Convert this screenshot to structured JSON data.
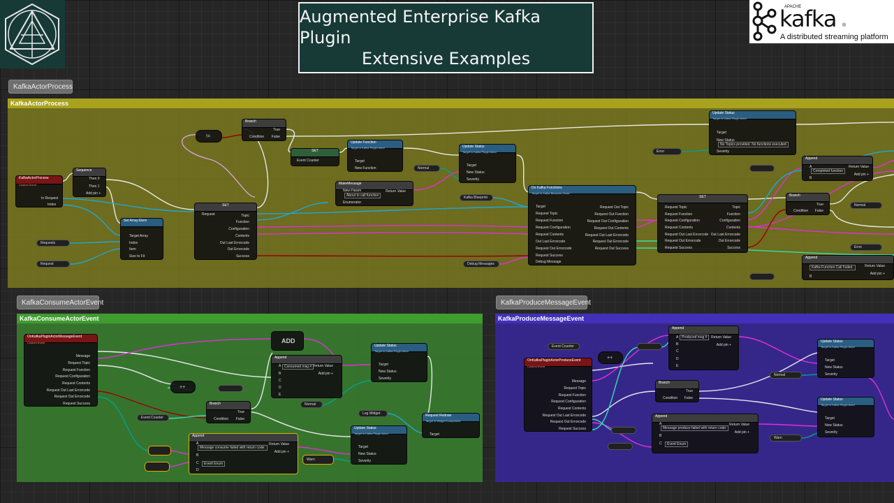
{
  "header": {
    "title_line1": "Augmented Enterprise Kafka Plugin",
    "title_line2": "Extensive Examples",
    "kafka_apache": "APACHE",
    "kafka_word": "kafka",
    "kafka_reg": "®",
    "kafka_tagline": "A distributed streaming platform"
  },
  "colors": {
    "exec": "#ffffff",
    "string": "#e02fd8",
    "object": "#1fa6d6",
    "enum": "#00a38e",
    "bool": "#9a0000",
    "int": "#33e0b0",
    "olive": "#8a8a1e",
    "green": "#2e8a2c",
    "purple": "#3a2d9e"
  },
  "groups": {
    "actor": {
      "tab": "KafkaActorProcess",
      "header": "KafkaActorProcess"
    },
    "consume": {
      "tab": "KafkaConsumeActorEvent",
      "header": "KafkaConsumeActorEvent"
    },
    "produce": {
      "tab": "KafkaProduceMessageEvent",
      "header": "KafkaProduceMessageEvent"
    }
  },
  "nodes": {
    "kap": {
      "title": "KafkaActorProcess",
      "sub": "Custom Event",
      "p1": "In Request",
      "p2": "Index"
    },
    "seq": {
      "title": "Sequence",
      "p1": "Then 0",
      "p2": "Then 1",
      "p3": "Add pin +"
    },
    "setarr": {
      "title": "Set Array Elem",
      "p1": "Target Array",
      "p2": "Index",
      "p3": "Item",
      "p4": "Size to Fit"
    },
    "requests": "Requests",
    "request": "Request",
    "set1": {
      "title": "SET",
      "p1": "Request",
      "p2": "Topic",
      "p3": "Function",
      "p4": "Configuration",
      "p5": "Contents",
      "p6": "Out Last Errorcode",
      "p7": "Out Errorcode",
      "p8": "Success"
    },
    "branch1": {
      "title": "Branch",
      "p1": "Condition",
      "p2": "True",
      "p3": "False"
    },
    "set_ec": {
      "title": "SET",
      "p1": "Event Counter"
    },
    "updfunc": {
      "title": "Update Function",
      "sub": "Target is Kafka Plugin Actor",
      "p1": "Target",
      "p2": "New Function"
    },
    "makemsg": {
      "title": "MakeMessage",
      "p1": "New Param",
      "p2": "Enumerator",
      "p3": "Return Value",
      "val": "About to call function"
    },
    "upd1": {
      "title": "Update Status",
      "sub": "Target is Kafka Plugin Actor",
      "p1": "Target",
      "p2": "New Status",
      "p3": "Severity"
    },
    "normal": "Normal",
    "kafka_bp": "Kafka Blueprint",
    "dokafka": {
      "title": "Do Kafka Functions",
      "sub": "Target is Kafka Blueprint Class",
      "p1": "Target",
      "p2": "Request Topic",
      "p3": "Request Function",
      "p4": "Request Configuration",
      "p5": "Request Contents",
      "p6": "Out Last Errorcode",
      "p7": "Request Out Errorcode",
      "p8": "Request Success",
      "p9": "Debug Message",
      "o1": "Request Out Topic",
      "o2": "Request Out Function",
      "o3": "Request Out Configuration",
      "o4": "Request Out Contents",
      "o5": "Request Out Last Errorcode",
      "o6": "Request Out Errorcode",
      "o7": "Request Out Success"
    },
    "debug_messages": "Debug Messages",
    "set2": {
      "title": "SET",
      "p1": "Request Topic",
      "p2": "Request Function",
      "p3": "Request Configuration",
      "p4": "Request Contents",
      "p5": "Request Out Last Errorcode",
      "p6": "Request Out Errorcode",
      "p7": "Request Success",
      "o1": "Topic",
      "o2": "Function",
      "o3": "Configuration",
      "o4": "Contents",
      "o5": "Out Last Errorcode",
      "o6": "Out Errorcode",
      "o7": "Success"
    },
    "upd_top": {
      "title": "Update Status",
      "sub": "Target is Kafka Plugin Actor",
      "p1": "Target",
      "p2": "New Status",
      "p3": "Severity",
      "val": "No Topics provided. No functions executed"
    },
    "error1": "Error",
    "append1": {
      "title": "Append",
      "p1": "A",
      "p2": "B",
      "p3": "Return Value",
      "p4": "Add pin +",
      "val": "Completed function"
    },
    "branch2": {
      "title": "Branch",
      "p1": "Condition",
      "p2": "True",
      "p3": "False"
    },
    "normal2": "Normal",
    "error2": "Error",
    "append2": {
      "title": "Append",
      "p1": "A",
      "p2": "B",
      "p3": "Return Value",
      "p4": "Add pin +",
      "val": "Kafka Function Call Failed."
    },
    "c_event": {
      "title": "OnKafkaPluginActorMessageEvent",
      "sub": "Custom Event",
      "p1": "Message",
      "p2": "Request Topic",
      "p3": "Request Function",
      "p4": "Request Configuration",
      "p5": "Request Contents",
      "p6": "Request Out Last Errorcode",
      "p7": "Request Out Errorcode",
      "p8": "Request Success"
    },
    "c_add": "ADD",
    "c_append": {
      "title": "Append",
      "p1": "A",
      "p2": "B",
      "p3": "C",
      "p4": "D",
      "p5": "E",
      "o1": "Return Value",
      "o2": "Add pin +",
      "val": "Consumed msg #"
    },
    "c_upd1": {
      "title": "Update Status",
      "sub": "Target is Kafka Plugin Actor",
      "p1": "Target",
      "p2": "New Status",
      "p3": "Severity"
    },
    "c_normal": "Normal",
    "c_branch": {
      "title": "Branch",
      "p1": "Condition",
      "p2": "True",
      "p3": "False"
    },
    "c_event_counter": "Event Counter",
    "c_log": "Log Widget",
    "c_redraw": {
      "title": "Request Redraw",
      "sub": "Target is Widget Component",
      "p1": "Target"
    },
    "c_upd2": {
      "title": "Update Status",
      "sub": "Target is Kafka Plugin Actor",
      "p1": "Target",
      "p2": "New Status",
      "p3": "Severity"
    },
    "c_append2": {
      "title": "Append",
      "p1": "A",
      "p2": "B",
      "p3": "C",
      "p4": "D",
      "o1": "Return Value",
      "o2": "Add pin +",
      "val": "Message consume failed with return code:",
      "val2": "Event Enum"
    },
    "c_warn": "Warn",
    "p_event": {
      "title": "OnKafkaPluginActorProduceEvent",
      "sub": "Custom Event",
      "p1": "Message",
      "p2": "Request Topic",
      "p3": "Request Function",
      "p4": "Request Configuration",
      "p5": "Request Contents",
      "p6": "Request Out Last Errorcode",
      "p7": "Request Out Errorcode",
      "p8": "Request Success"
    },
    "p_event_counter": "Event Counter",
    "p_append": {
      "title": "Append",
      "p1": "A",
      "p2": "B",
      "p3": "C",
      "p4": "D",
      "p5": "E",
      "o1": "Return Value",
      "o2": "Add pin +",
      "val": "Produced msg #"
    },
    "p_branch": {
      "title": "Branch",
      "p1": "Condition",
      "p2": "True",
      "p3": "False"
    },
    "p_normal": "Normal",
    "p_upd1": {
      "title": "Update Status",
      "sub": "Target is Kafka Plugin Actor",
      "p1": "Target",
      "p2": "New Status",
      "p3": "Severity"
    },
    "p_upd2": {
      "title": "Update Status",
      "sub": "Target is Kafka Plugin Actor",
      "p1": "Target",
      "p2": "New Status",
      "p3": "Severity"
    },
    "p_append2": {
      "title": "Append",
      "p1": "A",
      "p2": "B",
      "p3": "C",
      "o1": "Return Value",
      "o2": "Add pin +",
      "val": "Message produce failed with return code:",
      "val2": "Event Enum"
    },
    "p_warn": "Warn"
  }
}
